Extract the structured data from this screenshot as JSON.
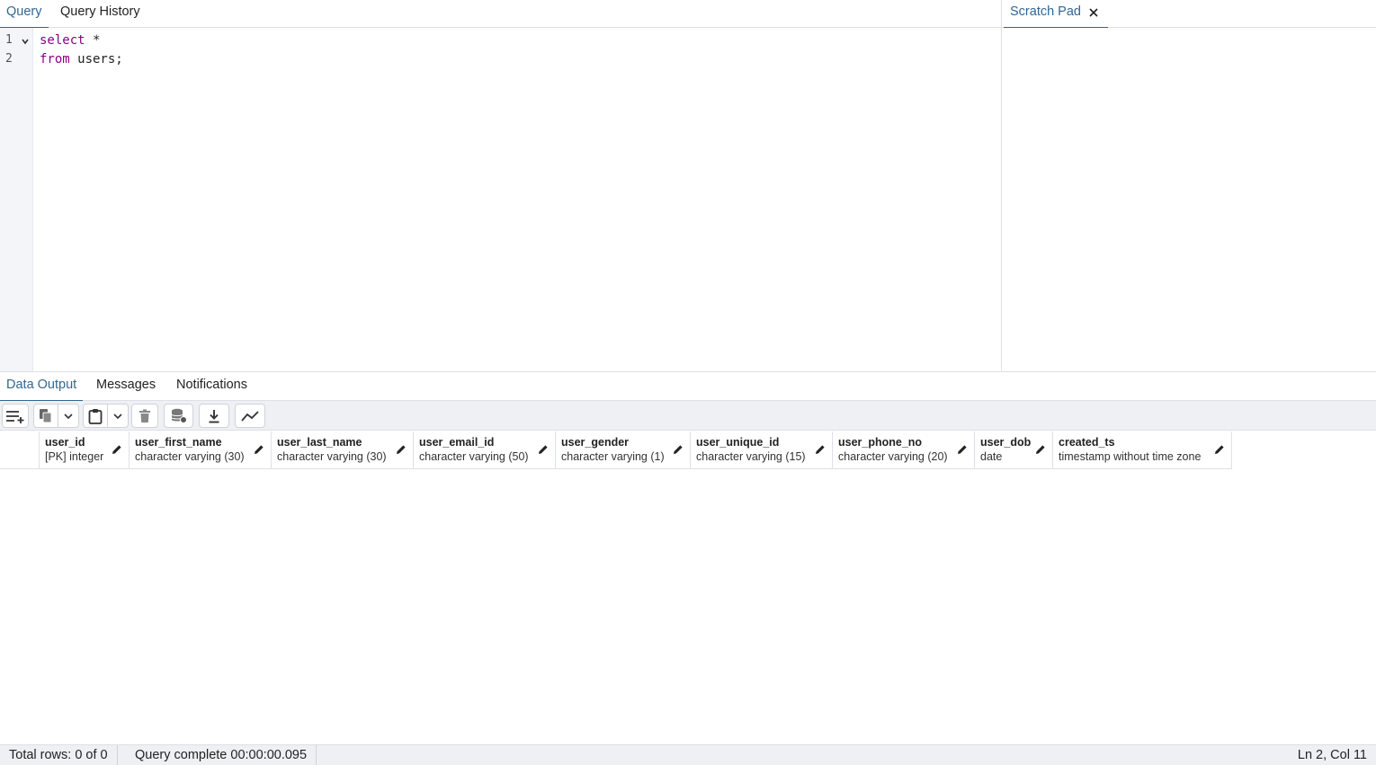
{
  "top_tabs": {
    "query": "Query",
    "history": "Query History",
    "scratch": "Scratch Pad"
  },
  "editor": {
    "lines": [
      {
        "no": "1",
        "keyword": "select",
        "rest": " *"
      },
      {
        "no": "2",
        "keyword": "from",
        "rest": " users;"
      }
    ]
  },
  "bottom_tabs": {
    "data_output": "Data Output",
    "messages": "Messages",
    "notifications": "Notifications"
  },
  "toolbar": {
    "icons": [
      "add-row-icon",
      "copy-icon",
      "dropdown-icon",
      "paste-icon",
      "dropdown-icon",
      "delete-icon",
      "save-data-icon",
      "download-icon",
      "graph-icon"
    ]
  },
  "columns": [
    {
      "name": "user_id",
      "type": "[PK] integer"
    },
    {
      "name": "user_first_name",
      "type": "character varying (30)"
    },
    {
      "name": "user_last_name",
      "type": "character varying (30)"
    },
    {
      "name": "user_email_id",
      "type": "character varying (50)"
    },
    {
      "name": "user_gender",
      "type": "character varying (1)"
    },
    {
      "name": "user_unique_id",
      "type": "character varying (15)"
    },
    {
      "name": "user_phone_no",
      "type": "character varying (20)"
    },
    {
      "name": "user_dob",
      "type": "date"
    },
    {
      "name": "created_ts",
      "type": "timestamp without time zone"
    }
  ],
  "status": {
    "total_rows": "Total rows: 0 of 0",
    "query_complete": "Query complete 00:00:00.095",
    "cursor_pos": "Ln 2, Col 11"
  },
  "colors": {
    "accent": "#326690",
    "keyword": "#8b0082"
  }
}
